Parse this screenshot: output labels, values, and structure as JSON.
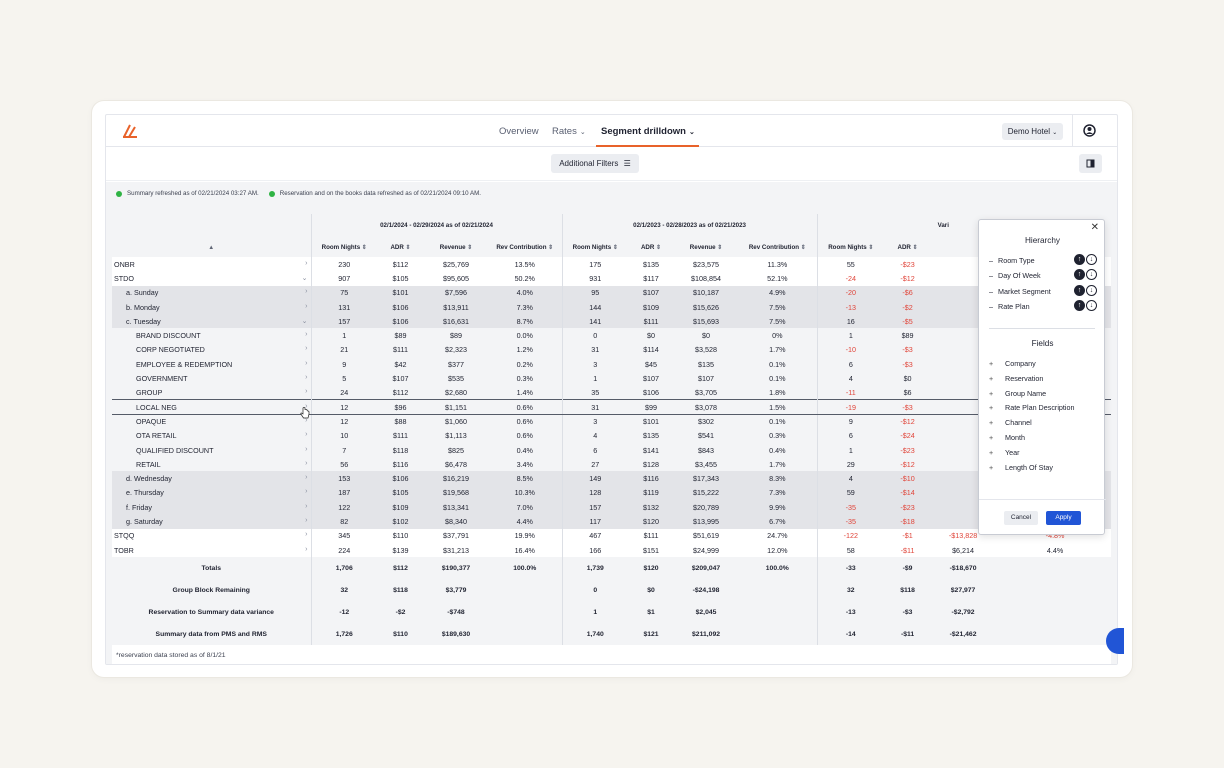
{
  "nav": {
    "items": [
      {
        "label": "Overview",
        "chevron": false
      },
      {
        "label": "Rates",
        "chevron": true
      },
      {
        "label": "Segment drilldown",
        "chevron": true,
        "active": true
      }
    ],
    "hotel_label": "Demo Hotel",
    "accent_color": "#e8622a"
  },
  "toolbar": {
    "filters_label": "Additional Filters"
  },
  "refresh": {
    "summary": "Summary refreshed as of 02/21/2024 03:27 AM.",
    "reservation": "Reservation and on the books data refreshed as of 02/21/2024 09:10 AM."
  },
  "table": {
    "groups": [
      "02/1/2024 - 02/29/2024 as of 02/21/2024",
      "02/1/2023 - 02/28/2023 as of 02/21/2023",
      "Vari"
    ],
    "columns": [
      "Room Nights",
      "ADR",
      "Revenue",
      "Rev Contribution",
      "Room Nights",
      "ADR",
      "Revenue",
      "Rev Contribution",
      "Room Nights",
      "ADR",
      "",
      ""
    ],
    "rows": [
      {
        "label": "ONBR",
        "level": 0,
        "arrow": "›",
        "style": "",
        "cells": [
          "230",
          "$112",
          "$25,769",
          "13.5%",
          "175",
          "$135",
          "$23,575",
          "11.3%",
          "55",
          "-$23",
          "",
          ""
        ]
      },
      {
        "label": "STDO",
        "level": 0,
        "arrow": "⌄",
        "style": "",
        "cells": [
          "907",
          "$105",
          "$95,605",
          "50.2%",
          "931",
          "$117",
          "$108,854",
          "52.1%",
          "-24",
          "-$12",
          "",
          ""
        ]
      },
      {
        "label": "a. Sunday",
        "level": 1,
        "arrow": "›",
        "style": "shade",
        "cells": [
          "75",
          "$101",
          "$7,596",
          "4.0%",
          "95",
          "$107",
          "$10,187",
          "4.9%",
          "-20",
          "-$6",
          "",
          ""
        ]
      },
      {
        "label": "b. Monday",
        "level": 1,
        "arrow": "›",
        "style": "shade",
        "cells": [
          "131",
          "$106",
          "$13,911",
          "7.3%",
          "144",
          "$109",
          "$15,626",
          "7.5%",
          "-13",
          "-$2",
          "",
          ""
        ]
      },
      {
        "label": "c. Tuesday",
        "level": 1,
        "arrow": "⌄",
        "style": "shade",
        "cells": [
          "157",
          "$106",
          "$16,631",
          "8.7%",
          "141",
          "$111",
          "$15,693",
          "7.5%",
          "16",
          "-$5",
          "",
          ""
        ]
      },
      {
        "label": "BRAND DISCOUNT",
        "level": 2,
        "arrow": "›",
        "style": "lt",
        "cells": [
          "1",
          "$89",
          "$89",
          "0.0%",
          "0",
          "$0",
          "$0",
          "0%",
          "1",
          "$89",
          "",
          ""
        ]
      },
      {
        "label": "CORP NEGOTIATED",
        "level": 2,
        "arrow": "›",
        "style": "lt",
        "cells": [
          "21",
          "$111",
          "$2,323",
          "1.2%",
          "31",
          "$114",
          "$3,528",
          "1.7%",
          "-10",
          "-$3",
          "",
          ""
        ]
      },
      {
        "label": "EMPLOYEE & REDEMPTION",
        "level": 2,
        "arrow": "›",
        "style": "lt",
        "cells": [
          "9",
          "$42",
          "$377",
          "0.2%",
          "3",
          "$45",
          "$135",
          "0.1%",
          "6",
          "-$3",
          "",
          ""
        ]
      },
      {
        "label": "GOVERNMENT",
        "level": 2,
        "arrow": "›",
        "style": "lt",
        "cells": [
          "5",
          "$107",
          "$535",
          "0.3%",
          "1",
          "$107",
          "$107",
          "0.1%",
          "4",
          "$0",
          "",
          ""
        ]
      },
      {
        "label": "GROUP",
        "level": 2,
        "arrow": "›",
        "style": "lt",
        "cells": [
          "24",
          "$112",
          "$2,680",
          "1.4%",
          "35",
          "$106",
          "$3,705",
          "1.8%",
          "-11",
          "$6",
          "",
          ""
        ]
      },
      {
        "label": "LOCAL NEG",
        "level": 2,
        "arrow": "›",
        "style": "hl",
        "cells": [
          "12",
          "$96",
          "$1,151",
          "0.6%",
          "31",
          "$99",
          "$3,078",
          "1.5%",
          "-19",
          "-$3",
          "",
          ""
        ]
      },
      {
        "label": "OPAQUE",
        "level": 2,
        "arrow": "›",
        "style": "lt",
        "cells": [
          "12",
          "$88",
          "$1,060",
          "0.6%",
          "3",
          "$101",
          "$302",
          "0.1%",
          "9",
          "-$12",
          "",
          ""
        ]
      },
      {
        "label": "OTA RETAIL",
        "level": 2,
        "arrow": "›",
        "style": "lt",
        "cells": [
          "10",
          "$111",
          "$1,113",
          "0.6%",
          "4",
          "$135",
          "$541",
          "0.3%",
          "6",
          "-$24",
          "",
          ""
        ]
      },
      {
        "label": "QUALIFIED DISCOUNT",
        "level": 2,
        "arrow": "›",
        "style": "lt",
        "cells": [
          "7",
          "$118",
          "$825",
          "0.4%",
          "6",
          "$141",
          "$843",
          "0.4%",
          "1",
          "-$23",
          "",
          ""
        ]
      },
      {
        "label": "RETAIL",
        "level": 2,
        "arrow": "›",
        "style": "lt",
        "cells": [
          "56",
          "$116",
          "$6,478",
          "3.4%",
          "27",
          "$128",
          "$3,455",
          "1.7%",
          "29",
          "-$12",
          "",
          ""
        ]
      },
      {
        "label": "d. Wednesday",
        "level": 1,
        "arrow": "›",
        "style": "shade",
        "cells": [
          "153",
          "$106",
          "$16,219",
          "8.5%",
          "149",
          "$116",
          "$17,343",
          "8.3%",
          "4",
          "-$10",
          "",
          ""
        ]
      },
      {
        "label": "e. Thursday",
        "level": 1,
        "arrow": "›",
        "style": "shade",
        "cells": [
          "187",
          "$105",
          "$19,568",
          "10.3%",
          "128",
          "$119",
          "$15,222",
          "7.3%",
          "59",
          "-$14",
          "",
          ""
        ]
      },
      {
        "label": "f. Friday",
        "level": 1,
        "arrow": "›",
        "style": "shade",
        "cells": [
          "122",
          "$109",
          "$13,341",
          "7.0%",
          "157",
          "$132",
          "$20,789",
          "9.9%",
          "-35",
          "-$23",
          "",
          ""
        ]
      },
      {
        "label": "g. Saturday",
        "level": 1,
        "arrow": "›",
        "style": "shade",
        "cells": [
          "82",
          "$102",
          "$8,340",
          "4.4%",
          "117",
          "$120",
          "$13,995",
          "6.7%",
          "-35",
          "-$18",
          "",
          ""
        ]
      },
      {
        "label": "STQQ",
        "level": 0,
        "arrow": "›",
        "style": "",
        "cells": [
          "345",
          "$110",
          "$37,791",
          "19.9%",
          "467",
          "$111",
          "$51,619",
          "24.7%",
          "-122",
          "-$1",
          "-$13,828",
          "-4.8%"
        ]
      },
      {
        "label": "TOBR",
        "level": 0,
        "arrow": "›",
        "style": "",
        "cells": [
          "224",
          "$139",
          "$31,213",
          "16.4%",
          "166",
          "$151",
          "$24,999",
          "12.0%",
          "58",
          "-$11",
          "$6,214",
          "4.4%"
        ]
      }
    ],
    "totals": [
      {
        "label": "Totals",
        "cells": [
          "1,706",
          "$112",
          "$190,377",
          "100.0%",
          "1,739",
          "$120",
          "$209,047",
          "100.0%",
          "-33",
          "-$9",
          "-$18,670",
          ""
        ]
      },
      {
        "label": "Group Block Remaining",
        "cells": [
          "32",
          "$118",
          "$3,779",
          "",
          "0",
          "$0",
          "-$24,198",
          "",
          "32",
          "$118",
          "$27,977",
          ""
        ]
      },
      {
        "label": "Reservation to Summary data variance",
        "cells": [
          "-12",
          "-$2",
          "-$748",
          "",
          "1",
          "$1",
          "$2,045",
          "",
          "-13",
          "-$3",
          "-$2,792",
          ""
        ]
      },
      {
        "label": "Summary data from PMS and RMS",
        "cells": [
          "1,726",
          "$110",
          "$189,630",
          "",
          "1,740",
          "$121",
          "$211,092",
          "",
          "-14",
          "-$11",
          "-$21,462",
          ""
        ]
      }
    ],
    "footnote": "*reservation data stored as of 8/1/21"
  },
  "popup": {
    "hierarchy_title": "Hierarchy",
    "hierarchy": [
      "Room Type",
      "Day Of Week",
      "Market Segment",
      "Rate Plan"
    ],
    "fields_title": "Fields",
    "fields": [
      "Company",
      "Reservation",
      "Group Name",
      "Rate Plan Description",
      "Channel",
      "Month",
      "Year",
      "Length Of Stay"
    ],
    "cancel_label": "Cancel",
    "apply_label": "Apply"
  }
}
